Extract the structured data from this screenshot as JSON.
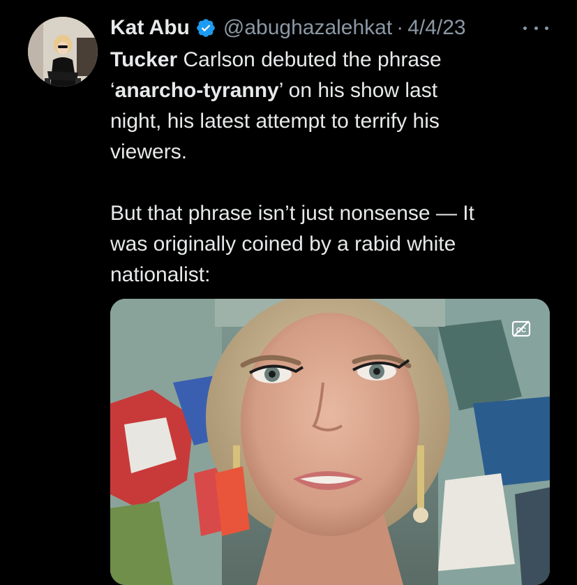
{
  "tweet": {
    "display_name": "Kat Abu",
    "handle": "@abughazalehkat",
    "separator": "·",
    "date": "4/4/23",
    "more_icon": "more-horizontal-icon",
    "verified_icon": "verified-badge-icon",
    "body": {
      "line1_bold": "Tucker",
      "line1_rest": " Carlson debuted the phrase",
      "line2_open_quote": "‘",
      "line2_bold": "anarcho-tyranny",
      "line2_rest": "’ on his show last",
      "line3": "night, his latest attempt to terrify his",
      "line4": "viewers.",
      "para2_line1": "But that phrase isn’t just nonsense — It",
      "para2_line2": "was originally coined by a rabid white",
      "para2_line3": "nationalist:"
    },
    "media": {
      "type": "video",
      "caption_icon": "closed-captions-off-icon"
    }
  },
  "colors": {
    "background": "#000000",
    "text_primary": "#e7e9ea",
    "text_secondary": "#8b98a5",
    "verified_blue": "#1d9bf0"
  }
}
